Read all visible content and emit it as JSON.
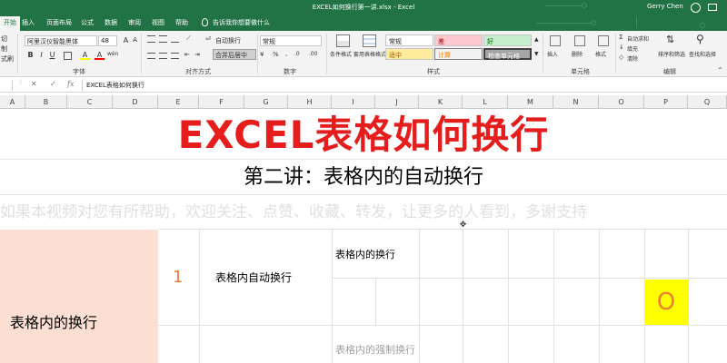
{
  "window": {
    "title": "EXCEL如何换行第一讲.xlsx  -  Excel",
    "user": "Gerry Chen"
  },
  "tabs": [
    {
      "label": "开始",
      "active": true
    },
    {
      "label": "插入"
    },
    {
      "label": "页面布局"
    },
    {
      "label": "公式"
    },
    {
      "label": "数据"
    },
    {
      "label": "审阅"
    },
    {
      "label": "视图"
    },
    {
      "label": "帮助"
    }
  ],
  "tell_me": "告诉我你想要做什么",
  "ribbon": {
    "clipboard": {
      "cut": "切",
      "copy": "制",
      "format_painter": "式刷"
    },
    "font": {
      "font_name": "阿里汉仪智能黑体",
      "font_size": "48",
      "grow": "A",
      "shrink": "A",
      "bold": "B",
      "italic": "I",
      "underline": "U",
      "font_color": "A",
      "highlight": "A",
      "phonetic": "wén",
      "group_label": "字体"
    },
    "alignment": {
      "wrap_text": "自动换行",
      "merge_center": "合并后居中",
      "group_label": "对齐方式"
    },
    "number": {
      "format": "常规",
      "percent": "%",
      "comma": ",",
      "group_label": "数字"
    },
    "styles": {
      "conditional": "条件格式",
      "table_format": "套用表格格式",
      "normal": "常规",
      "bad": "差",
      "good": "好",
      "neutral": "适中",
      "calculation": "计算",
      "check_cell": "检查单元格",
      "group_label": "样式"
    },
    "cells": {
      "insert": "插入",
      "delete": "删除",
      "format": "格式",
      "group_label": "单元格"
    },
    "editing": {
      "autosum": "自动求和",
      "fill": "填充",
      "clear": "清除",
      "sort_filter": "排序和筛选",
      "find_select": "查找和选择",
      "group_label": "编辑"
    }
  },
  "formula_bar": {
    "name_box": "",
    "content": "EXCEL表格如何换行"
  },
  "columns": [
    "A",
    "B",
    "C",
    "D",
    "E",
    "F",
    "G",
    "H",
    "I",
    "J",
    "K",
    "L",
    "M",
    "N",
    "O",
    "P",
    "Q"
  ],
  "sheet": {
    "title": "EXCEL表格如何换行",
    "subtitle": "第二讲：表格内的自动换行",
    "notice": "如果本视频对您有所帮助，欢迎关注、点赞、收藏、转发，让更多的人看到，多谢支持",
    "section_label": "表格内的换行",
    "item_number": "1",
    "item_label": "表格内自动换行",
    "wrap_cell": "表格内的换行",
    "forced_cell": "表格内的强制换行",
    "marker": "O"
  },
  "colors": {
    "excel_green": "#217346",
    "title_red": "#e51d1d",
    "pink_fill": "#fdded3",
    "yellow_fill": "#ffff00",
    "orange_text": "#ed8033"
  }
}
